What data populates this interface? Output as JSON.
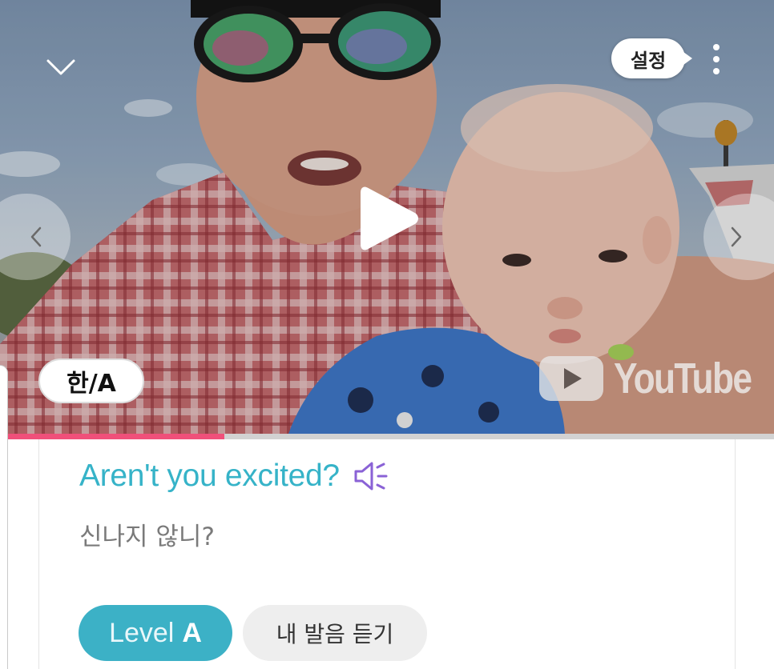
{
  "player": {
    "settings_label": "설정",
    "lang_toggle_label": "한/A",
    "watermark_text": "YouTube",
    "progress_fraction": 0.29,
    "icons": {
      "collapse": "chevron-down-icon",
      "more": "more-vertical-icon",
      "prev": "chevron-left-icon",
      "next": "chevron-right-icon",
      "play": "play-icon",
      "watermark": "youtube-logo-icon"
    }
  },
  "card": {
    "sentence_en": "Aren't you excited?",
    "sentence_ko": "신나지 않니?",
    "speaker_icon": "speaker-icon",
    "level_prefix": "Level",
    "level_value": "A",
    "pronunciation_label": "내 발음 듣기"
  },
  "colors": {
    "accent_teal": "#3cb1c6",
    "sentence_text": "#36b3c8",
    "speaker_purple": "#8a62d6",
    "progress_pink": "#f0507a",
    "progress_track": "#d2d2d2"
  }
}
